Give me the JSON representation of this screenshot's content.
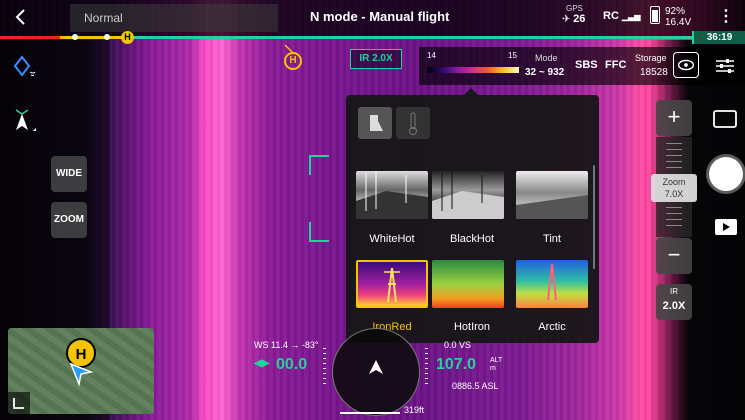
{
  "topbar": {
    "mode": "Normal",
    "title": "N mode - Manual flight",
    "gps_label": "GPS",
    "satellites": "26",
    "rc_label": "RC",
    "battery_percent": "92%",
    "battery_voltage": "16.4V",
    "flight_time": "36:19"
  },
  "left_controls": {
    "wide_label": "WIDE",
    "zoom_label": "ZOOM"
  },
  "home_marker": "H",
  "ir_badge": "IR 2.0X",
  "palette_strip": {
    "temp_min": "14",
    "temp_max": "15",
    "mode_label": "Mode",
    "mode_range": "32 ~ 932",
    "sbs_label": "SBS",
    "ffc_label": "FFC",
    "storage_label": "Storage",
    "storage_value": "18528"
  },
  "palette_popup": {
    "palettes": [
      {
        "label": "WhiteHot",
        "selected": false
      },
      {
        "label": "BlackHot",
        "selected": false
      },
      {
        "label": "Tint",
        "selected": false
      },
      {
        "label": "IronRed",
        "selected": true
      },
      {
        "label": "HotIron",
        "selected": false
      },
      {
        "label": "Arctic",
        "selected": false
      }
    ]
  },
  "zoom": {
    "plus": "+",
    "minus": "−",
    "tag_label": "Zoom",
    "tag_value": "7.0X",
    "ir_label": "IR",
    "ir_value": "2.0X"
  },
  "telemetry": {
    "wind": "WS 11.4 → -83°",
    "horizontal_speed": "00.0",
    "vertical_speed": "0.0 VS",
    "altitude": "107.0",
    "altitude_unit_top": "ALT",
    "altitude_unit_bottom": "m",
    "asl": "0886.5 ASL",
    "distance": "319ft"
  },
  "minimap": {
    "home": "H"
  },
  "colors": {
    "accent": "#1fd39a",
    "home": "#f5c400",
    "selected_palette": "#f5c400"
  }
}
